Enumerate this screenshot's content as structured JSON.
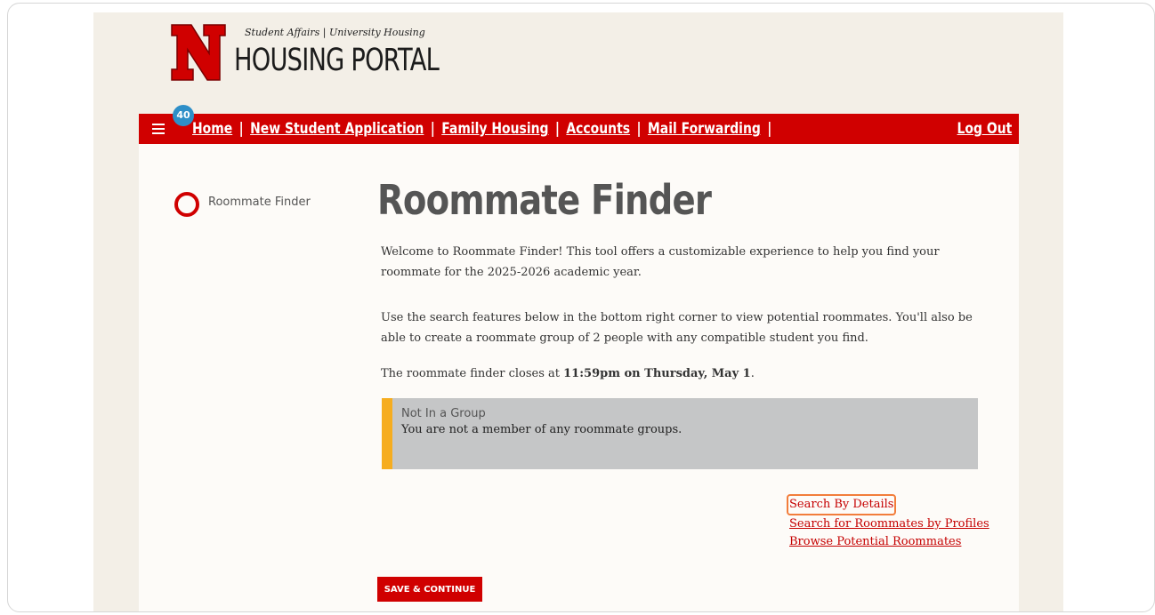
{
  "header": {
    "subtitle": "Student Affairs | University Housing",
    "title": "HOUSING PORTAL",
    "logo_letter": "N",
    "brand_color": "#d00000"
  },
  "nav": {
    "badge_count": "40",
    "items": [
      {
        "label": "Home"
      },
      {
        "label": "New Student Application"
      },
      {
        "label": "Family Housing"
      },
      {
        "label": "Accounts"
      },
      {
        "label": "Mail Forwarding"
      }
    ],
    "separator": "|",
    "logout_label": "Log Out"
  },
  "sidebar": {
    "step_label": "Roommate Finder"
  },
  "main": {
    "heading": "Roommate Finder",
    "para1": "Welcome to Roommate Finder! This tool offers a customizable experience to help you find your roommate for the 2025-2026 academic year.",
    "para2": "Use the search features below in the bottom right corner to view potential roommates. You'll also be able to create a roommate group of 2 people with any compatible student you find.",
    "para3_prefix": "The roommate finder closes at ",
    "para3_bold": "11:59pm on Thursday, May 1",
    "para3_suffix": ".",
    "alert": {
      "title": "Not In a Group",
      "body": "You are not a member of any roommate groups.",
      "accent_color": "#f6ad1f"
    },
    "links": [
      {
        "label": "Search By Details",
        "highlighted": true
      },
      {
        "label": "Search for Roommates by Profiles"
      },
      {
        "label": "Browse Potential Roommates"
      }
    ],
    "save_button": "SAVE & CONTINUE"
  }
}
